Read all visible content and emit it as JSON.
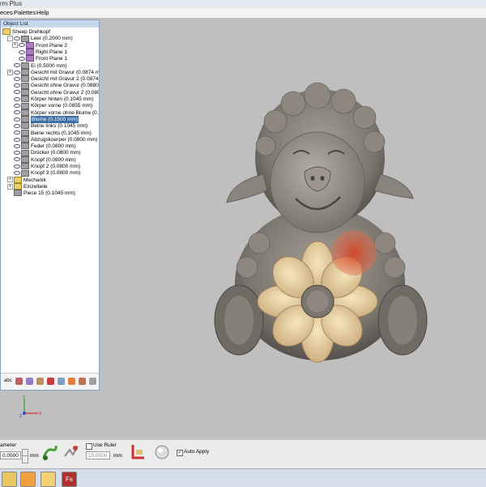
{
  "title": "rm Plus",
  "menu": [
    "eces",
    "Palettes",
    "Help"
  ],
  "object_list": {
    "title": "Object List",
    "items": [
      {
        "label": "Sheep Drehkopf",
        "indent": 0,
        "icon": "folder",
        "exp": ""
      },
      {
        "label": "Leer (0.2000 mm)",
        "indent": 1,
        "icon": "relief",
        "exp": "-",
        "eye": true
      },
      {
        "label": "Front Plane 2",
        "indent": 2,
        "icon": "plane",
        "exp": "+",
        "eye": true
      },
      {
        "label": "Right Plane 1",
        "indent": 2,
        "icon": "plane",
        "exp": "",
        "eye": true
      },
      {
        "label": "Front Plane 1",
        "indent": 2,
        "icon": "plane",
        "exp": "",
        "eye": true
      },
      {
        "label": "Ei (0.5000 mm)",
        "indent": 1,
        "icon": "relief",
        "exp": "",
        "eye": true
      },
      {
        "label": "Gesicht mit Gravur (0.0874 m",
        "indent": 1,
        "icon": "relief",
        "exp": "+",
        "eye": true
      },
      {
        "label": "Gesicht mit Gravur 2 (0.0874 m",
        "indent": 1,
        "icon": "relief",
        "exp": "",
        "eye": true
      },
      {
        "label": "Gesicht ohne Gravur (0.0880",
        "indent": 1,
        "icon": "relief",
        "exp": "",
        "eye": true
      },
      {
        "label": "Gesicht ohne Gravur 2 (0.080",
        "indent": 1,
        "icon": "relief",
        "exp": "",
        "eye": true
      },
      {
        "label": "Körper hinten (0.1045 mm)",
        "indent": 1,
        "icon": "relief",
        "exp": "",
        "eye": true
      },
      {
        "label": "Körper vorne (0.0855 mm)",
        "indent": 1,
        "icon": "relief",
        "exp": "",
        "eye": true
      },
      {
        "label": "Körper vorne ohne Blume (0.",
        "indent": 1,
        "icon": "relief",
        "exp": "",
        "eye": true
      },
      {
        "label": "Blume (0.1500 mm)",
        "indent": 1,
        "icon": "relief",
        "exp": "",
        "eye": true,
        "selected": true
      },
      {
        "label": "Beine links (0.1045 mm)",
        "indent": 1,
        "icon": "relief",
        "exp": "",
        "eye": true
      },
      {
        "label": "Beine rechts (0.1045 mm)",
        "indent": 1,
        "icon": "relief",
        "exp": "",
        "eye": true
      },
      {
        "label": "Abzugskoerper (0.0800 mm)",
        "indent": 1,
        "icon": "relief",
        "exp": "",
        "eye": true
      },
      {
        "label": "Feder (0.0800 mm)",
        "indent": 1,
        "icon": "relief",
        "exp": "",
        "eye": true
      },
      {
        "label": "Drücker (0.0800 mm)",
        "indent": 1,
        "icon": "relief",
        "exp": "",
        "eye": true
      },
      {
        "label": "Knopf (0.0800 mm)",
        "indent": 1,
        "icon": "relief",
        "exp": "",
        "eye": true
      },
      {
        "label": "Knopf 2 (0.0800 mm)",
        "indent": 1,
        "icon": "relief",
        "exp": "",
        "eye": true
      },
      {
        "label": "Knopf 3 (0.0800 mm)",
        "indent": 1,
        "icon": "relief",
        "exp": "",
        "eye": true
      },
      {
        "label": "Mechanik",
        "indent": 1,
        "icon": "folder",
        "exp": "+",
        "eye": false
      },
      {
        "label": "Einzelteile",
        "indent": 1,
        "icon": "folder",
        "exp": "+",
        "eye": false
      },
      {
        "label": "Piece 15 (0.1045 mm)",
        "indent": 1,
        "icon": "relief",
        "exp": "",
        "eye": false
      }
    ],
    "tools_first": "abc"
  },
  "bottom": {
    "label": "ameter",
    "value": "0.0500",
    "unit": "mm",
    "use_ruler_label": "Use Ruler",
    "ruler_value": "10.0000",
    "ruler_unit": "mm",
    "auto_apply_label": "Auto Apply",
    "auto_apply_checked": "✓"
  },
  "axis": {
    "y": "Y",
    "x": "X",
    "z": "Z"
  },
  "taskbar_icons": [
    "folder-icon",
    "media-icon",
    "app-icon",
    "fs-app-icon"
  ],
  "colors": {
    "model": "#8c8680",
    "flower": "#e8d2a0",
    "highlight": "#d05030",
    "selection": "#3a6ea5"
  }
}
